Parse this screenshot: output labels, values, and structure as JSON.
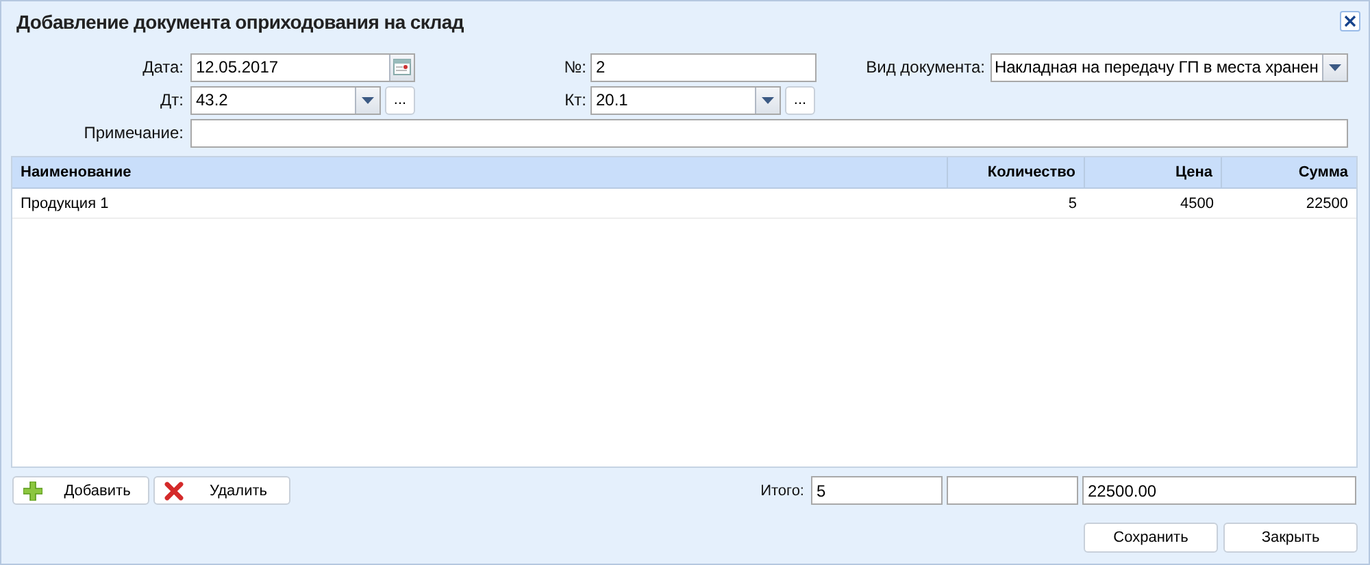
{
  "window": {
    "title": "Добавление документа оприходования на склад"
  },
  "form": {
    "date": {
      "label": "Дата:",
      "value": "12.05.2017"
    },
    "number": {
      "label": "№:",
      "value": "2"
    },
    "doc_type": {
      "label": "Вид документа:",
      "value": "Накладная на передачу ГП в места хранен"
    },
    "debit": {
      "label": "Дт:",
      "value": "43.2",
      "more": "..."
    },
    "credit": {
      "label": "Кт:",
      "value": "20.1",
      "more": "..."
    },
    "note": {
      "label": "Примечание:"
    }
  },
  "table": {
    "columns": [
      "Наименование",
      "Количество",
      "Цена",
      "Сумма"
    ],
    "rows": [
      [
        "Продукция 1",
        "5",
        "4500",
        "22500"
      ]
    ]
  },
  "toolbar": [
    {
      "kind": "add",
      "label": "Добавить"
    },
    {
      "kind": "delete",
      "label": "Удалить"
    }
  ],
  "totals": {
    "label": "Итого:",
    "quantity": "5",
    "sum": "22500.00"
  },
  "buttons": [
    "Сохранить",
    "Закрыть"
  ]
}
